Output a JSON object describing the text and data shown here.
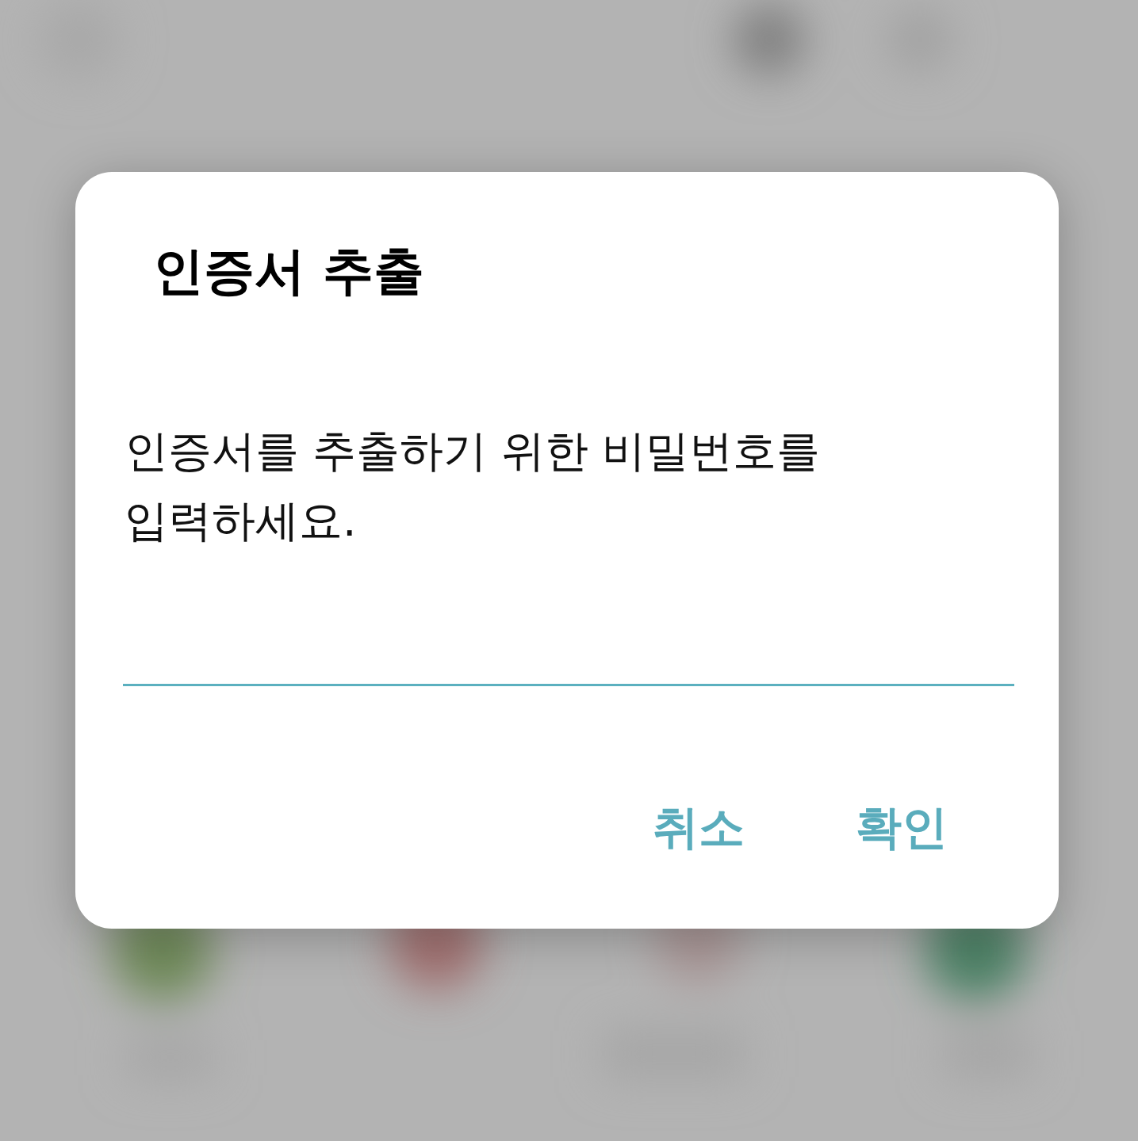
{
  "dialog": {
    "title": "인증서 추출",
    "message": "인증서를 추출하기 위한 비밀번호를 입력하세요.",
    "buttons": [
      {
        "label": "취소"
      },
      {
        "label": "확인"
      }
    ]
  }
}
